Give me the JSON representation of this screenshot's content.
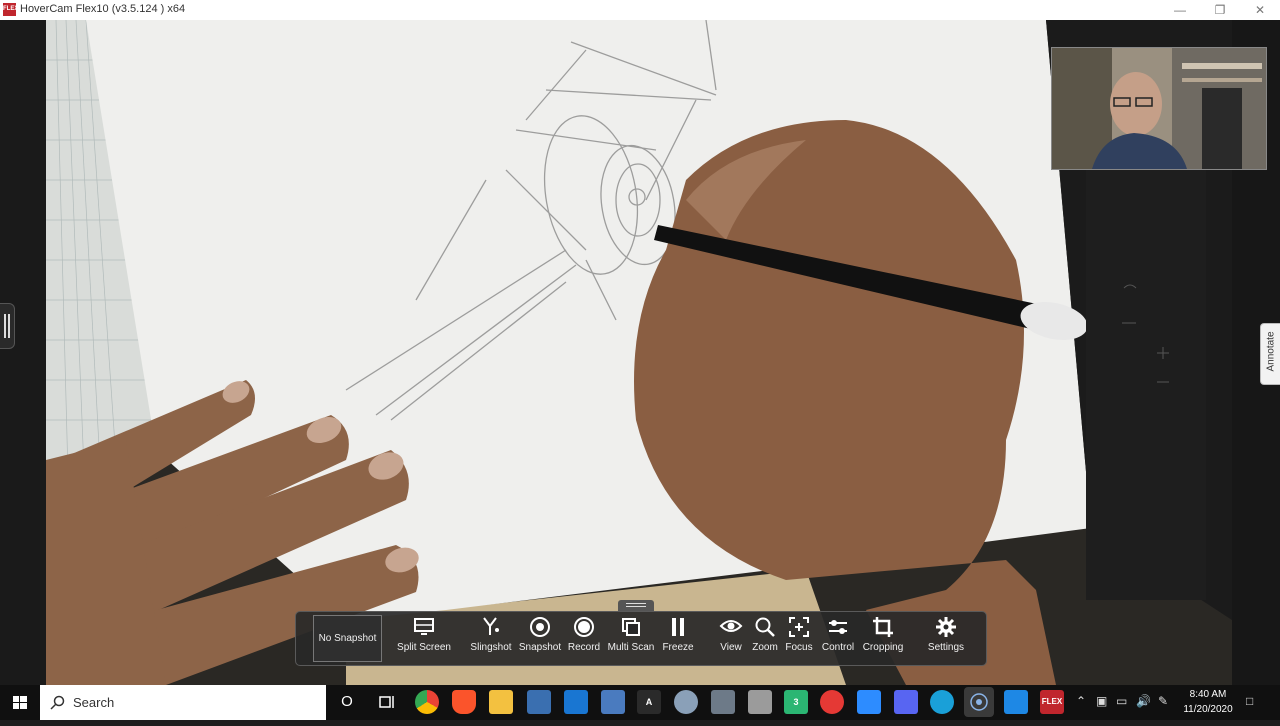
{
  "window": {
    "title": "HoverCam Flex10 (v3.5.124 ) x64",
    "app_icon_text": "FLEX",
    "controls": [
      "minimize-icon",
      "restore-icon",
      "close-icon"
    ]
  },
  "annotate": {
    "label": "Annotate"
  },
  "toolbar": {
    "no_snapshot": "No Snapshot",
    "tools": [
      {
        "label": "Split Screen",
        "icon": "split-screen-icon"
      },
      {
        "label": "Slingshot",
        "icon": "slingshot-icon"
      },
      {
        "label": "Snapshot",
        "icon": "snapshot-icon"
      },
      {
        "label": "Record",
        "icon": "record-icon"
      },
      {
        "label": "Multi Scan",
        "icon": "multi-scan-icon"
      },
      {
        "label": "Freeze",
        "icon": "freeze-icon"
      },
      {
        "label": "View",
        "icon": "eye-icon"
      },
      {
        "label": "Zoom",
        "icon": "zoom-icon"
      },
      {
        "label": "Focus",
        "icon": "focus-icon"
      },
      {
        "label": "Control",
        "icon": "control-icon"
      },
      {
        "label": "Cropping",
        "icon": "crop-icon"
      },
      {
        "label": "Settings",
        "icon": "gear-icon"
      }
    ]
  },
  "taskbar": {
    "search_label": "Search",
    "apps": [
      {
        "name": "cortana",
        "label": "O"
      },
      {
        "name": "task-view",
        "label": ""
      },
      {
        "name": "chrome",
        "label": ""
      },
      {
        "name": "brave",
        "label": ""
      },
      {
        "name": "file-explorer",
        "label": ""
      },
      {
        "name": "store",
        "label": ""
      },
      {
        "name": "mail",
        "label": ""
      },
      {
        "name": "calculator",
        "label": ""
      },
      {
        "name": "adobe",
        "label": ""
      },
      {
        "name": "app-bird",
        "label": ""
      },
      {
        "name": "app-wing",
        "label": ""
      },
      {
        "name": "app-cap",
        "label": ""
      },
      {
        "name": "app-3",
        "label": "3"
      },
      {
        "name": "app-red",
        "label": ""
      },
      {
        "name": "zoom",
        "label": ""
      },
      {
        "name": "discord",
        "label": ""
      },
      {
        "name": "app-globe",
        "label": ""
      },
      {
        "name": "hovercam",
        "label": ""
      },
      {
        "name": "app-chat",
        "label": ""
      },
      {
        "name": "flex10",
        "label": "FLEX"
      }
    ],
    "clock_time": "8:40 AM",
    "clock_date": "11/20/2020",
    "colors": {
      "background": "#101010",
      "accent": "#c0262d"
    }
  }
}
